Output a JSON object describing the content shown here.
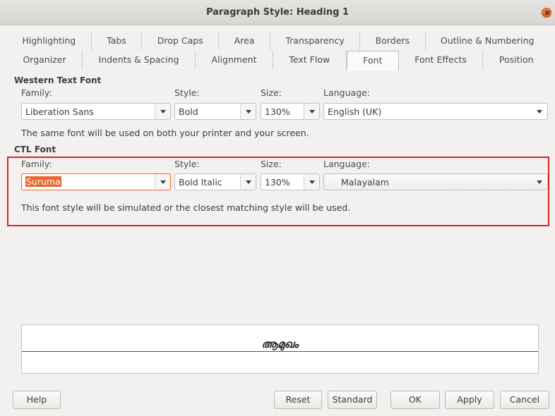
{
  "window": {
    "title": "Paragraph Style: Heading 1"
  },
  "tabs": {
    "row1": [
      "Highlighting",
      "Tabs",
      "Drop Caps",
      "Area",
      "Transparency",
      "Borders",
      "Outline & Numbering"
    ],
    "row2": [
      "Organizer",
      "Indents & Spacing",
      "Alignment",
      "Text Flow",
      "Font",
      "Font Effects",
      "Position"
    ],
    "active": "Font"
  },
  "western": {
    "section_title": "Western Text Font",
    "family_label": "Family:",
    "style_label": "Style:",
    "size_label": "Size:",
    "language_label": "Language:",
    "family_value": "Liberation Sans",
    "style_value": "Bold",
    "size_value": "130%",
    "language_value": "English (UK)",
    "info": "The same font will be used on both your printer and your screen."
  },
  "ctl": {
    "section_title": "CTL Font",
    "family_label": "Family:",
    "style_label": "Style:",
    "size_label": "Size:",
    "language_label": "Language:",
    "family_value": "Suruma",
    "style_value": "Bold Italic",
    "size_value": "130%",
    "language_value": "Malayalam",
    "info": "This font style will be simulated or the closest matching style will be used."
  },
  "preview": {
    "sample_text": "ആമുഖം"
  },
  "buttons": {
    "help": "Help",
    "reset": "Reset",
    "standard": "Standard",
    "ok": "OK",
    "apply": "Apply",
    "cancel": "Cancel"
  },
  "colors": {
    "highlight_border": "#d6242b",
    "selection": "#e9672f"
  }
}
